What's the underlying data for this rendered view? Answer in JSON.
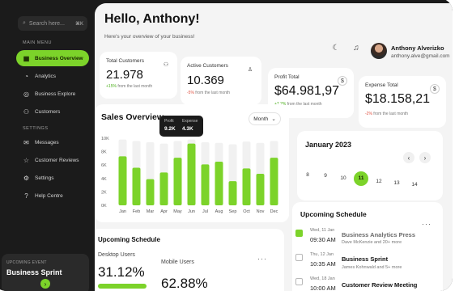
{
  "sidebar": {
    "search_placeholder": "Search here...",
    "search_shortcut": "⌘K",
    "menu_heading": "MAIN MENU",
    "settings_heading": "SETTINGS",
    "items": [
      {
        "label": "Business Overview",
        "icon": "grid-icon"
      },
      {
        "label": "Analytics",
        "icon": "analytics-icon"
      },
      {
        "label": "Business Explore",
        "icon": "compass-icon"
      },
      {
        "label": "Customers",
        "icon": "users-icon"
      },
      {
        "label": "Messages",
        "icon": "message-icon"
      },
      {
        "label": "Customer Reviews",
        "icon": "review-icon"
      },
      {
        "label": "Settings",
        "icon": "gear-icon"
      },
      {
        "label": "Help Centre",
        "icon": "help-icon"
      }
    ],
    "event": {
      "label": "UPCOMING EVENT",
      "title": "Business Sprint"
    }
  },
  "header": {
    "greeting": "Hello, Anthony!",
    "subtitle": "Here's your overview of your business!",
    "user_name": "Anthony Alverizko",
    "user_email": "anthony.alve@gmail.com"
  },
  "stats": [
    {
      "label": "Total Customers",
      "value": "21.978",
      "change": "+15%",
      "change_rest": "from the last month",
      "trend": "up"
    },
    {
      "label": "Active Customers",
      "value": "10.369",
      "change": "-5%",
      "change_rest": "from the last month",
      "trend": "down"
    },
    {
      "label": "Profit Total",
      "value": "$64.981,97",
      "change": "+7.2%",
      "change_rest": "from the last month",
      "trend": "up"
    },
    {
      "label": "Expense Total",
      "value": "$18.158,21",
      "change": "-2%",
      "change_rest": "from the last month",
      "trend": "down"
    }
  ],
  "sales": {
    "title": "Sales Overview",
    "period": "Month",
    "tooltip": {
      "profit_label": "Profit",
      "profit_value": "9.2K",
      "expense_label": "Expense",
      "expense_value": "4.3K"
    }
  },
  "chart_data": {
    "type": "bar",
    "title": "Sales Overview",
    "categories": [
      "Jan",
      "Feb",
      "Mar",
      "Apr",
      "May",
      "Jun",
      "Jul",
      "Aug",
      "Sep",
      "Oct",
      "Nov",
      "Dec"
    ],
    "yticks": [
      "10K",
      "8K",
      "6K",
      "4K",
      "2K",
      "0K"
    ],
    "ylim": [
      0,
      10
    ],
    "series": [
      {
        "name": "Profit",
        "values": [
          7.3,
          5.6,
          3.9,
          4.9,
          7.1,
          9.2,
          6.1,
          6.5,
          3.6,
          5.5,
          4.7,
          7.1
        ],
        "color": "#7cd32a"
      },
      {
        "name": "Expense",
        "values": [
          9.8,
          9.6,
          9.4,
          9.2,
          9.6,
          9.8,
          9.4,
          9.3,
          9.1,
          9.5,
          9.3,
          9.6
        ],
        "color": "#f1f1f1"
      }
    ]
  },
  "calendar": {
    "title": "January 2023",
    "days": [
      "8",
      "9",
      "10",
      "11",
      "12",
      "13",
      "14"
    ],
    "selected": "11"
  },
  "schedule": {
    "title": "Upcoming Schedule",
    "items": [
      {
        "day": "Wed, 11 Jan",
        "time": "09:30 AM",
        "title": "Business Analytics Press",
        "sub": "Dave McKenzie and 20+ more",
        "done": true
      },
      {
        "day": "Thu, 12 Jan",
        "time": "10:35 AM",
        "title": "Business Sprint",
        "sub": "James Kohnwald and 5+ more",
        "done": false
      },
      {
        "day": "Wed, 18 Jan",
        "time": "10:00 AM",
        "title": "Customer Review Meeting",
        "sub": "",
        "done": false
      }
    ]
  },
  "schedule2": {
    "title": "Upcoming Schedule",
    "desktop_label": "Desktop Users",
    "desktop_value": "31.12%",
    "mobile_label": "Mobile Users",
    "mobile_value": "62.88%"
  },
  "colors": {
    "accent": "#7cd32a",
    "sidebar": "#1b1b1b",
    "panel": "#f4f4f4"
  }
}
